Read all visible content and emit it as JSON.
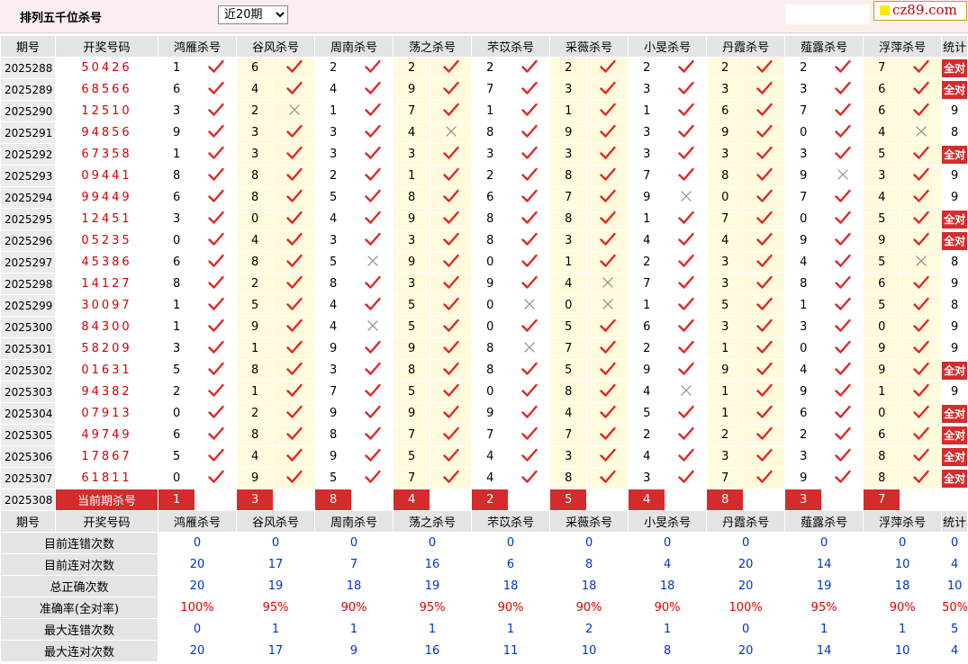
{
  "header": {
    "title": "排列五千位杀号",
    "period_selected": "近20期",
    "period_options": [
      "近20期"
    ],
    "brand": "cz89.com",
    "brand_color": "#c10000"
  },
  "columns": {
    "period": "期号",
    "draw": "开奖号码",
    "experts": [
      "鸿雁杀号",
      "谷风杀号",
      "周南杀号",
      "荡之杀号",
      "芣苡杀号",
      "采薇杀号",
      "小旻杀号",
      "丹霞杀号",
      "薤露杀号",
      "浮萍杀号"
    ],
    "stats": "统计"
  },
  "rows": [
    {
      "period": "2025288",
      "draw": "50426",
      "kills": [
        1,
        6,
        2,
        2,
        2,
        2,
        2,
        2,
        2,
        7
      ],
      "hits": [
        1,
        1,
        1,
        1,
        1,
        1,
        1,
        1,
        1,
        1
      ],
      "stat": "全对"
    },
    {
      "period": "2025289",
      "draw": "68566",
      "kills": [
        6,
        4,
        4,
        9,
        7,
        3,
        3,
        3,
        3,
        6
      ],
      "hits": [
        1,
        1,
        1,
        1,
        1,
        1,
        1,
        1,
        1,
        1
      ],
      "stat": "全对"
    },
    {
      "period": "2025290",
      "draw": "12510",
      "kills": [
        3,
        2,
        1,
        7,
        1,
        1,
        1,
        6,
        7,
        6
      ],
      "hits": [
        1,
        0,
        1,
        1,
        1,
        1,
        1,
        1,
        1,
        1
      ],
      "stat": "9"
    },
    {
      "period": "2025291",
      "draw": "94856",
      "kills": [
        9,
        3,
        3,
        4,
        8,
        9,
        3,
        9,
        0,
        4
      ],
      "hits": [
        1,
        1,
        1,
        0,
        1,
        1,
        1,
        1,
        1,
        0
      ],
      "stat": "8"
    },
    {
      "period": "2025292",
      "draw": "67358",
      "kills": [
        1,
        3,
        3,
        3,
        3,
        3,
        3,
        3,
        3,
        5
      ],
      "hits": [
        1,
        1,
        1,
        1,
        1,
        1,
        1,
        1,
        1,
        1
      ],
      "stat": "全对"
    },
    {
      "period": "2025293",
      "draw": "09441",
      "kills": [
        8,
        8,
        2,
        1,
        2,
        8,
        7,
        8,
        9,
        3
      ],
      "hits": [
        1,
        1,
        1,
        1,
        1,
        1,
        1,
        1,
        0,
        1
      ],
      "stat": "9"
    },
    {
      "period": "2025294",
      "draw": "99449",
      "kills": [
        6,
        8,
        5,
        8,
        6,
        7,
        9,
        0,
        7,
        4
      ],
      "hits": [
        1,
        1,
        1,
        1,
        1,
        1,
        0,
        1,
        1,
        1
      ],
      "stat": "9"
    },
    {
      "period": "2025295",
      "draw": "12451",
      "kills": [
        3,
        0,
        4,
        9,
        8,
        8,
        1,
        7,
        0,
        5
      ],
      "hits": [
        1,
        1,
        1,
        1,
        1,
        1,
        1,
        1,
        1,
        1
      ],
      "stat": "全对"
    },
    {
      "period": "2025296",
      "draw": "05235",
      "kills": [
        0,
        4,
        3,
        3,
        8,
        3,
        4,
        4,
        9,
        9
      ],
      "hits": [
        1,
        1,
        1,
        1,
        1,
        1,
        1,
        1,
        1,
        1
      ],
      "stat": "全对"
    },
    {
      "period": "2025297",
      "draw": "45386",
      "kills": [
        6,
        8,
        5,
        9,
        0,
        1,
        2,
        3,
        4,
        5
      ],
      "hits": [
        1,
        1,
        0,
        1,
        1,
        1,
        1,
        1,
        1,
        0
      ],
      "stat": "8"
    },
    {
      "period": "2025298",
      "draw": "14127",
      "kills": [
        8,
        2,
        8,
        3,
        9,
        4,
        7,
        3,
        8,
        6
      ],
      "hits": [
        1,
        1,
        1,
        1,
        1,
        0,
        1,
        1,
        1,
        1
      ],
      "stat": "9"
    },
    {
      "period": "2025299",
      "draw": "30097",
      "kills": [
        1,
        5,
        4,
        5,
        0,
        0,
        1,
        5,
        1,
        5
      ],
      "hits": [
        1,
        1,
        1,
        1,
        0,
        0,
        1,
        1,
        1,
        1
      ],
      "stat": "8"
    },
    {
      "period": "2025300",
      "draw": "84300",
      "kills": [
        1,
        9,
        4,
        5,
        0,
        5,
        6,
        3,
        3,
        0
      ],
      "hits": [
        1,
        1,
        0,
        1,
        1,
        1,
        1,
        1,
        1,
        1
      ],
      "stat": "9"
    },
    {
      "period": "2025301",
      "draw": "58209",
      "kills": [
        3,
        1,
        9,
        9,
        8,
        7,
        2,
        1,
        0,
        9
      ],
      "hits": [
        1,
        1,
        1,
        1,
        0,
        1,
        1,
        1,
        1,
        1
      ],
      "stat": "9"
    },
    {
      "period": "2025302",
      "draw": "01631",
      "kills": [
        5,
        8,
        3,
        8,
        8,
        5,
        9,
        9,
        4,
        9
      ],
      "hits": [
        1,
        1,
        1,
        1,
        1,
        1,
        1,
        1,
        1,
        1
      ],
      "stat": "全对"
    },
    {
      "period": "2025303",
      "draw": "94382",
      "kills": [
        2,
        1,
        7,
        5,
        0,
        8,
        4,
        1,
        9,
        1
      ],
      "hits": [
        1,
        1,
        1,
        1,
        1,
        1,
        0,
        1,
        1,
        1
      ],
      "stat": "9"
    },
    {
      "period": "2025304",
      "draw": "07913",
      "kills": [
        0,
        2,
        9,
        9,
        9,
        4,
        5,
        1,
        6,
        0
      ],
      "hits": [
        1,
        1,
        1,
        1,
        1,
        1,
        1,
        1,
        1,
        1
      ],
      "stat": "全对"
    },
    {
      "period": "2025305",
      "draw": "49749",
      "kills": [
        6,
        8,
        8,
        7,
        7,
        7,
        2,
        2,
        2,
        6
      ],
      "hits": [
        1,
        1,
        1,
        1,
        1,
        1,
        1,
        1,
        1,
        1
      ],
      "stat": "全对"
    },
    {
      "period": "2025306",
      "draw": "17867",
      "kills": [
        5,
        4,
        9,
        5,
        4,
        3,
        4,
        3,
        3,
        8
      ],
      "hits": [
        1,
        1,
        1,
        1,
        1,
        1,
        1,
        1,
        1,
        1
      ],
      "stat": "全对"
    },
    {
      "period": "2025307",
      "draw": "61811",
      "kills": [
        0,
        9,
        5,
        7,
        4,
        8,
        3,
        7,
        9,
        8
      ],
      "hits": [
        1,
        1,
        1,
        1,
        1,
        1,
        1,
        1,
        1,
        1
      ],
      "stat": "全对"
    }
  ],
  "current": {
    "period": "2025308",
    "label": "当前期杀号",
    "kills": [
      "1",
      "3",
      "8",
      "4",
      "2",
      "5",
      "4",
      "8",
      "3",
      "7"
    ]
  },
  "summary": [
    {
      "label": "目前连错次数",
      "values": [
        "0",
        "0",
        "0",
        "0",
        "0",
        "0",
        "0",
        "0",
        "0",
        "0"
      ],
      "stat": "0"
    },
    {
      "label": "目前连对次数",
      "values": [
        "20",
        "17",
        "7",
        "16",
        "6",
        "8",
        "4",
        "20",
        "14",
        "10"
      ],
      "stat": "4"
    },
    {
      "label": "总正确次数",
      "values": [
        "20",
        "19",
        "18",
        "19",
        "18",
        "18",
        "18",
        "20",
        "19",
        "18"
      ],
      "stat": "10"
    },
    {
      "label": "准确率(全对率)",
      "values": [
        "100%",
        "95%",
        "90%",
        "95%",
        "90%",
        "90%",
        "90%",
        "100%",
        "95%",
        "90%"
      ],
      "stat": "50%",
      "is_rate": true
    },
    {
      "label": "最大连错次数",
      "values": [
        "0",
        "1",
        "1",
        "1",
        "1",
        "2",
        "1",
        "0",
        "1",
        "1"
      ],
      "stat": "5"
    },
    {
      "label": "最大连对次数",
      "values": [
        "20",
        "17",
        "9",
        "16",
        "11",
        "10",
        "8",
        "20",
        "14",
        "10"
      ],
      "stat": "4"
    }
  ],
  "colors": {
    "check": "#e02828",
    "cross": "#9a9a9a",
    "accent": "#d42c2c",
    "stat_blue": "#0033cc",
    "rate_red": "#e00000"
  }
}
